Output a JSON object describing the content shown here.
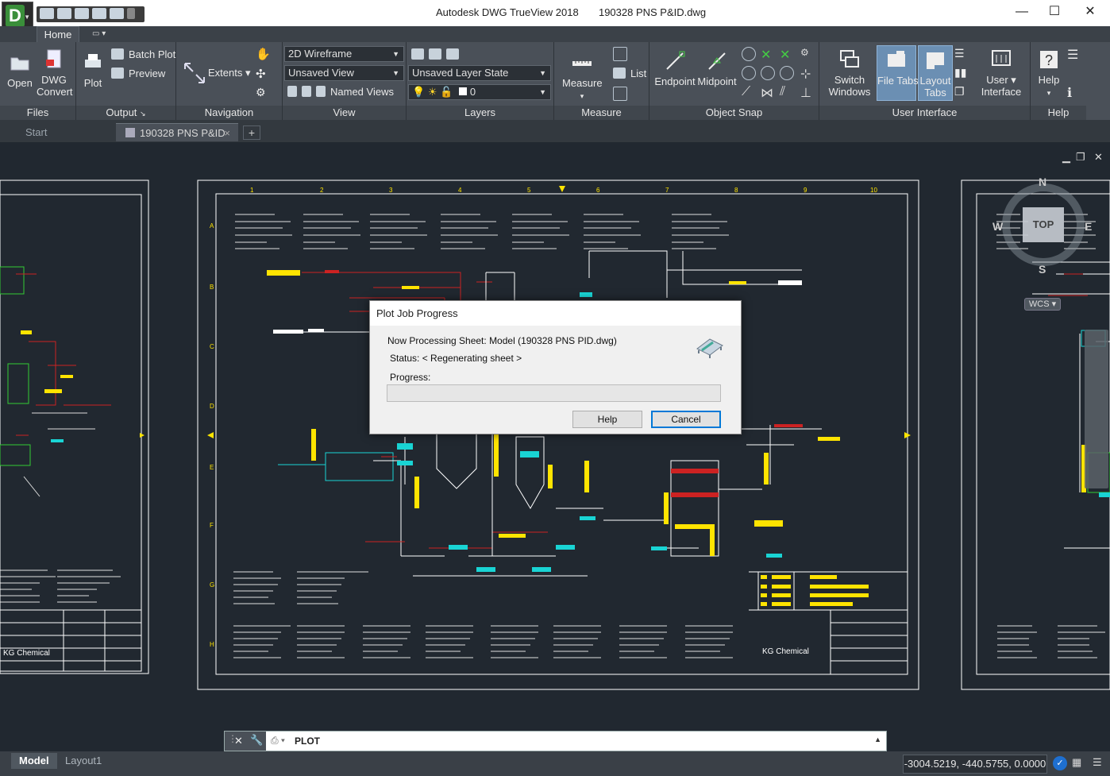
{
  "window": {
    "title": "Autodesk DWG TrueView 2018       190328 PNS P&ID.dwg",
    "app_letter": "D",
    "controls": {
      "minimize": "—",
      "maximize": "☐",
      "close": "✕"
    }
  },
  "ribbon": {
    "tab_home": "Home",
    "panels": {
      "files": {
        "title": "Files",
        "open": "Open",
        "dwg_convert_1": "DWG",
        "dwg_convert_2": "Convert"
      },
      "output": {
        "title": "Output",
        "plot": "Plot",
        "batch_plot": "Batch Plot",
        "preview": "Preview"
      },
      "navigation": {
        "title": "Navigation",
        "extents": "Extents"
      },
      "view": {
        "title": "View",
        "visual_style": "2D Wireframe",
        "saved_view": "Unsaved View",
        "named_views": "Named Views"
      },
      "layers": {
        "title": "Layers",
        "layer_state": "Unsaved Layer State",
        "current_layer": "0"
      },
      "measure": {
        "title": "Measure",
        "measure": "Measure",
        "list": "List"
      },
      "object_snap": {
        "title": "Object Snap",
        "endpoint": "Endpoint",
        "midpoint": "Midpoint"
      },
      "user_interface": {
        "title": "User Interface",
        "switch_1": "Switch",
        "switch_2": "Windows",
        "file_tabs": "File Tabs",
        "layout_1": "Layout",
        "layout_2": "Tabs",
        "user_1": "User",
        "user_2": "Interface"
      },
      "help": {
        "title": "Help",
        "help": "Help"
      }
    }
  },
  "doc_tabs": {
    "start": "Start",
    "active": "190328 PNS P&ID",
    "plus": "+"
  },
  "viewcube": {
    "north": "N",
    "south": "S",
    "west": "W",
    "east": "E",
    "top": "TOP",
    "wcs": "WCS"
  },
  "drawing": {
    "row_letters": [
      "A",
      "B",
      "C",
      "D",
      "E",
      "F",
      "G",
      "H"
    ],
    "col_numbers": [
      "1",
      "2",
      "3",
      "4",
      "5",
      "6",
      "7",
      "8",
      "9",
      "10"
    ],
    "logo": "KG Chemical",
    "right_logo": "KG Chemical"
  },
  "dialog": {
    "title": "Plot Job Progress",
    "processing": "Now Processing Sheet: Model (190328 PNS PID.dwg)",
    "status": "Status: < Regenerating sheet >",
    "progress_label": "Progress:",
    "progress_value": 0,
    "help_button": "Help",
    "cancel_button": "Cancel"
  },
  "command_line": {
    "text": "PLOT"
  },
  "status_bar": {
    "model_tab": "Model",
    "layout_tab": "Layout1",
    "coordinates": "-3004.5219, -440.5755, 0.0000"
  }
}
